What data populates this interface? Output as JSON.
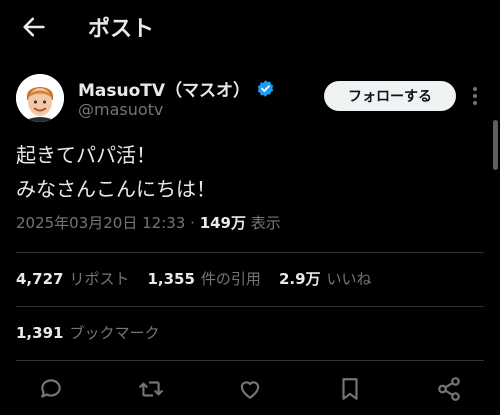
{
  "header": {
    "title": "ポスト"
  },
  "author": {
    "display_name": "MasuoTV（マスオ）",
    "handle": "@masuotv",
    "verified": true,
    "verified_color": "#1d9bf0"
  },
  "follow_label": "フォローする",
  "post": {
    "lines": [
      "起きてパパ活！",
      "みなさんこんにちは！"
    ],
    "timestamp": "2025年03月20日 12:33",
    "views_count": "149万",
    "views_label": "表示"
  },
  "stats": {
    "reposts_count": "4,727",
    "reposts_label": "リポスト",
    "quotes_count": "1,355",
    "quotes_label": "件の引用",
    "likes_count": "2.9万",
    "likes_label": "いいね",
    "bookmarks_count": "1,391",
    "bookmarks_label": "ブックマーク"
  },
  "icons": {
    "back": "arrow-left-icon",
    "more": "more-vertical-icon",
    "reply": "reply-icon",
    "repost": "repost-icon",
    "like": "heart-icon",
    "bookmark": "bookmark-icon",
    "share": "share-icon"
  }
}
